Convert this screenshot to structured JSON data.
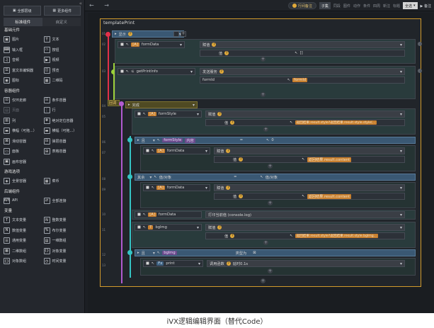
{
  "sidebar": {
    "top_buttons": [
      "全部层级",
      "更多组件"
    ],
    "tabs": [
      "标准组件",
      "自定义"
    ],
    "groups": [
      {
        "title": "基础元件",
        "items": [
          {
            "icon": "▣",
            "label": "图片"
          },
          {
            "icon": "T",
            "label": "文本"
          },
          {
            "icon": "⌨",
            "label": "输入框"
          },
          {
            "icon": "▭",
            "label": "按钮"
          },
          {
            "icon": "♫",
            "label": "音频"
          },
          {
            "icon": "▶",
            "label": "视频"
          },
          {
            "icon": "☰",
            "label": "富文本编辑器"
          },
          {
            "icon": "◫",
            "label": "预览"
          },
          {
            "icon": "◉",
            "label": "图标"
          },
          {
            "icon": "▦",
            "label": "二维码"
          }
        ]
      },
      {
        "title": "容器组件",
        "items": [
          {
            "icon": "⊡",
            "label": "仅环走廊"
          },
          {
            "icon": "☷",
            "label": "条件容器"
          },
          {
            "icon": "▤",
            "label": "页面",
            "dim": true
          },
          {
            "icon": "⋮",
            "label": "行"
          },
          {
            "icon": "▥",
            "label": "列"
          },
          {
            "icon": "✥",
            "label": "绝对定位容器"
          },
          {
            "icon": "▬",
            "label": "横幅（可拖...）"
          },
          {
            "icon": "▬",
            "label": "横幅（可拖...）"
          },
          {
            "icon": "⊠",
            "label": "滑动容器"
          },
          {
            "icon": "⊟",
            "label": "弹层容器"
          },
          {
            "icon": "▭",
            "label": "面板"
          },
          {
            "icon": "⊞",
            "label": "表格容器"
          },
          {
            "icon": "▣",
            "label": "画布容器"
          }
        ]
      },
      {
        "title": "游戏选项",
        "items": [
          {
            "icon": "◈",
            "label": "全景容器"
          },
          {
            "icon": "▦",
            "label": "菜币"
          }
        ]
      },
      {
        "title": "后端组件",
        "items": [
          {
            "icon": "API",
            "label": "API"
          },
          {
            "icon": "⇄",
            "label": "全部连接"
          }
        ]
      },
      {
        "title": "变量",
        "items": [
          {
            "icon": "T",
            "label": "文本变量"
          },
          {
            "icon": "N",
            "label": "整数变量"
          },
          {
            "icon": "N",
            "label": "数值变量"
          },
          {
            "icon": "%",
            "label": "布尔变量"
          },
          {
            "icon": "☰",
            "label": "通用变量"
          },
          {
            "icon": "▤",
            "label": "一维数组"
          },
          {
            "icon": "▦",
            "label": "二维数组"
          },
          {
            "icon": "{}",
            "label": "对象变量"
          },
          {
            "icon": "{}",
            "label": "对象数组"
          },
          {
            "icon": "◷",
            "label": "时间变量"
          }
        ]
      }
    ]
  },
  "topbar": {
    "nav": "← →",
    "toggle": "行间备注",
    "mode": "子集",
    "tools": [
      "同段",
      "图件",
      "动作",
      "条件",
      "四周",
      "新注",
      "标题"
    ],
    "dropdown": "全选",
    "side_label": "备注"
  },
  "panel": {
    "title": "templatePrint",
    "rows": {
      "r1": {
        "ln": "01",
        "text": "显示"
      },
      "r2": {
        "ln": "02",
        "target": "formData",
        "action": "赋值",
        "val_label": "值",
        "val": "[]"
      },
      "r3": {
        "ln": "03",
        "target": "getPrintInfo",
        "action": "发送服务",
        "param": "formId",
        "param_val": "formId"
      },
      "r4": {
        "ln": "04",
        "label": "回调",
        "text": "完成"
      },
      "r5": {
        "ln": "05",
        "target": "formStyle",
        "action": "赋值",
        "val_label": "值",
        "val": "返回结果.result.style?返回结果.result.style.style(..."
      },
      "r6": {
        "ln": "06",
        "kw": "且",
        "target": "formStyle",
        "target_sub": "内容",
        "op": "=",
        "val": "0"
      },
      "r7": {
        "ln": "07",
        "target": "formData",
        "action": "赋值",
        "val_label": "值",
        "val": "返回结果.result.content"
      },
      "r8": {
        "ln": "08",
        "kw": "其余",
        "a": "值/对象",
        "op": "=",
        "b": "值/对象"
      },
      "r9": {
        "ln": "09",
        "target": "formData",
        "action": "赋值",
        "val_label": "值",
        "val": "返回结果.result.content"
      },
      "r10": {
        "ln": "10",
        "target": "formData",
        "action": "打印当前值 (console.log)"
      },
      "r11": {
        "ln": "11",
        "target": "bgImg",
        "action": "赋值",
        "val_label": "值",
        "val": "返回结果.result.style?返回结果.result.style.bgImg..."
      },
      "r12": {
        "ln": "12",
        "kw": "且",
        "target": "bgImg",
        "op": "类型为",
        "val": "⊠"
      },
      "r13": {
        "ln": "13",
        "target": "print",
        "action": "调用函数",
        "param": "延时0.1s"
      }
    }
  },
  "caption": "iVX逻辑编辑界面（替代Code）",
  "colors": {
    "accent": "#d29a2c",
    "line_red": "#e0304a",
    "line_green": "#9bd13a",
    "line_purple": "#b25ad0",
    "line_cyan": "#35c4c4"
  }
}
